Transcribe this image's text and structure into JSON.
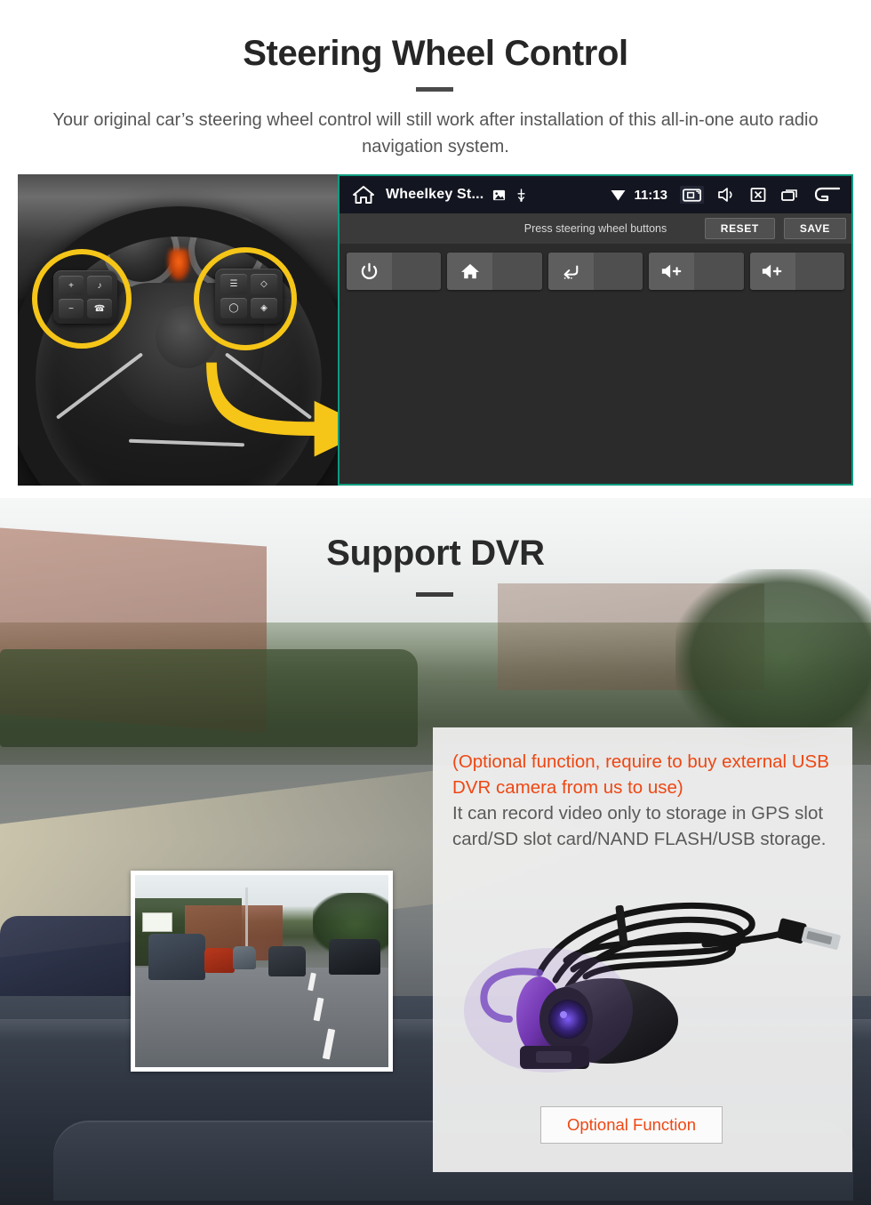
{
  "section_steering": {
    "title": "Steering Wheel Control",
    "subtitle": "Your original car’s steering wheel control will still work after installation of this all-in-one auto radio navigation system.",
    "photo_alt": "steering-wheel-with-highlighted-control-buttons",
    "android_screen": {
      "status_bar": {
        "home_icon": "home-icon",
        "app_title": "Wheelkey St...",
        "image_icon": "image-icon",
        "usb_icon": "usb-icon",
        "wifi_icon": "wifi-icon",
        "clock": "11:13",
        "screenshot_icon": "screenshot-icon",
        "mute_icon": "volume-mute-icon",
        "close_icon": "close-box-icon",
        "recents_icon": "recents-icon",
        "back_icon": "back-arrow-icon"
      },
      "toolbar": {
        "hint": "Press steering wheel buttons",
        "reset_label": "RESET",
        "save_label": "SAVE"
      },
      "keys": [
        {
          "icon": "power-icon",
          "glyph": "⏻"
        },
        {
          "icon": "home-icon",
          "glyph": "⌂"
        },
        {
          "icon": "back-return-icon",
          "glyph": "↩"
        },
        {
          "icon": "volume-up-icon",
          "glyph": "🔊+"
        },
        {
          "icon": "volume-up-icon",
          "glyph": "🔊+"
        }
      ],
      "accent_border": "#0f9b7e"
    },
    "wheel_pad_left_keys": [
      "+",
      "♪",
      "−",
      "☎"
    ],
    "wheel_pad_right_keys": [
      "☰",
      "◇",
      "◯",
      "◈"
    ],
    "highlight_color": "#f5c518"
  },
  "section_dvr": {
    "title": "Support DVR",
    "panel": {
      "note_red": "(Optional function, require to buy external USB DVR camera from us to use)",
      "note_gray": "It can record video only to storage in GPS slot card/SD slot card/NAND FLASH/USB storage.",
      "camera_alt": "usb-dvr-camera-with-cable",
      "optional_button": "Optional Function",
      "accent_color": "#ee4713"
    },
    "inset_alt": "dashcam-recorded-street-view"
  }
}
